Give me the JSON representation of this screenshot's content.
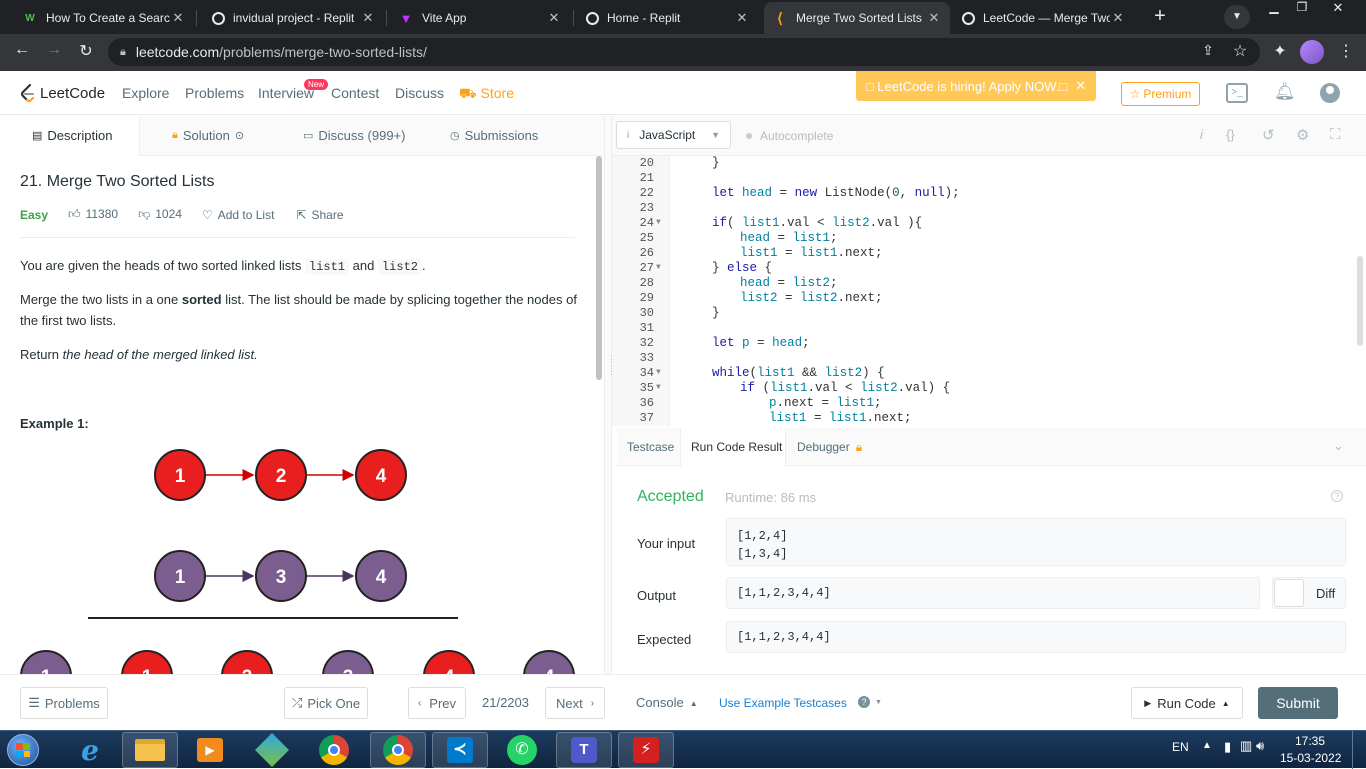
{
  "browser": {
    "tabs": [
      {
        "title": "How To Create a Search",
        "favicon": "W",
        "favcolor": "#5cb85c"
      },
      {
        "title": "invidual project - Replit",
        "favicon": "◎",
        "favcolor": "#e8eaed"
      },
      {
        "title": "Vite App",
        "favicon": "▼",
        "favcolor": "#bd34fe"
      },
      {
        "title": "Home - Replit",
        "favicon": "◎",
        "favcolor": "#e8eaed"
      },
      {
        "title": "Merge Two Sorted Lists",
        "favicon": "⟨",
        "favcolor": "#ffa116"
      },
      {
        "title": "LeetCode — Merge Two",
        "favicon": "◉",
        "favcolor": "#e8eaed"
      }
    ],
    "url_host": "leetcode.com",
    "url_path": "/problems/merge-two-sorted-lists/"
  },
  "nav": {
    "logo": "LeetCode",
    "items": [
      "Explore",
      "Problems",
      "Interview",
      "Contest",
      "Discuss",
      "Store"
    ],
    "new_badge": "New",
    "banner": "□ LeetCode is hiring! Apply NOW.□",
    "premium": "Premium"
  },
  "left_tabs": [
    "Description",
    "Solution",
    "Discuss (999+)",
    "Submissions"
  ],
  "problem": {
    "title": "21. Merge Two Sorted Lists",
    "difficulty": "Easy",
    "likes": "11380",
    "dislikes": "1024",
    "add_to_list": "Add to List",
    "share": "Share",
    "p1_a": "You are given the heads of two sorted linked lists",
    "p1_code1": "list1",
    "p1_and": "and",
    "p1_code2": "list2",
    "p1_end": ".",
    "p2_a": "Merge the two lists in a one",
    "p2_bold": "sorted",
    "p2_b": "list. The list should be made by splicing together the nodes of the first two lists.",
    "p3_a": "Return",
    "p3_i": "the head of the merged linked list.",
    "example": "Example 1:",
    "list1_nodes": [
      "1",
      "2",
      "4"
    ],
    "list2_nodes": [
      "1",
      "3",
      "4"
    ],
    "merged_nodes": [
      "1",
      "1",
      "2",
      "3",
      "4",
      "4"
    ]
  },
  "editor": {
    "language": "JavaScript",
    "autocomplete": "Autocomplete",
    "line_numbers": [
      "20",
      "21",
      "22",
      "23",
      "24",
      "25",
      "26",
      "27",
      "28",
      "29",
      "30",
      "31",
      "32",
      "33",
      "34",
      "35",
      "36",
      "37"
    ]
  },
  "result": {
    "tabs": [
      "Testcase",
      "Run Code Result",
      "Debugger"
    ],
    "status": "Accepted",
    "runtime": "Runtime: 86 ms",
    "input_label": "Your input",
    "input_value": "[1,2,4]\n[1,3,4]",
    "output_label": "Output",
    "output_value": "[1,1,2,3,4,4]",
    "diff": "Diff",
    "expected_label": "Expected",
    "expected_value": "[1,1,2,3,4,4]"
  },
  "bottom": {
    "problems": "Problems",
    "pick_one": "Pick One",
    "prev": "Prev",
    "counter": "21/2203",
    "next": "Next",
    "console": "Console",
    "use_example": "Use Example Testcases",
    "run_code": "Run Code",
    "submit": "Submit"
  },
  "taskbar": {
    "lang": "EN",
    "time": "17:35",
    "date": "15-03-2022"
  },
  "colors": {
    "accent": "#ffa116",
    "accepted": "#2db55d",
    "node_red": "#e91e1e",
    "node_purple": "#7b5e8f"
  }
}
